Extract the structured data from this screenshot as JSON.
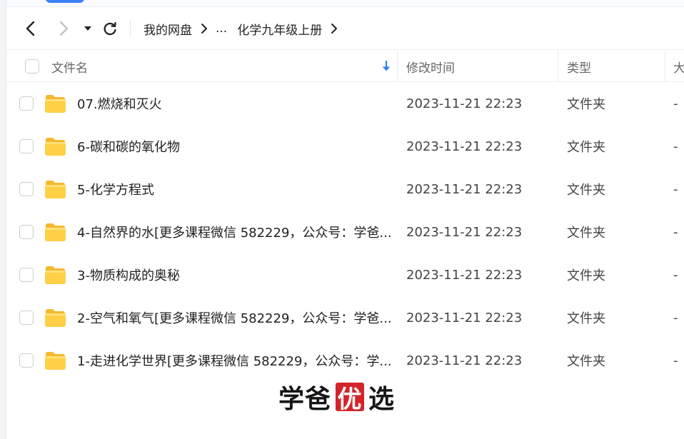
{
  "breadcrumb": {
    "root": "我的网盘",
    "ellipsis": "...",
    "current": "化学九年级上册"
  },
  "table": {
    "columns": {
      "name": "文件名",
      "modified": "修改时间",
      "type": "类型",
      "size": "大"
    },
    "sort_indicator": "arrow-down",
    "rows": [
      {
        "name": "07.燃烧和灭火",
        "modified": "2023-11-21 22:23",
        "type": "文件夹",
        "size": "-"
      },
      {
        "name": "6-碳和碳的氧化物",
        "modified": "2023-11-21 22:23",
        "type": "文件夹",
        "size": "-"
      },
      {
        "name": "5-化学方程式",
        "modified": "2023-11-21 22:23",
        "type": "文件夹",
        "size": "-"
      },
      {
        "name": "4-自然界的水[更多课程微信 582229，公众号：学爸...",
        "modified": "2023-11-21 22:23",
        "type": "文件夹",
        "size": "-"
      },
      {
        "name": "3-物质构成的奥秘",
        "modified": "2023-11-21 22:23",
        "type": "文件夹",
        "size": "-"
      },
      {
        "name": "2-空气和氧气[更多课程微信 582229，公众号：学爸...",
        "modified": "2023-11-21 22:23",
        "type": "文件夹",
        "size": "-"
      },
      {
        "name": "1-走进化学世界[更多课程微信 582229，公众号：学...",
        "modified": "2023-11-21 22:23",
        "type": "文件夹",
        "size": "-"
      }
    ]
  },
  "watermark": {
    "left": "学爸",
    "boxed": "优",
    "right": "选"
  },
  "colors": {
    "accent": "#3b82f6",
    "folder": "#ffc83d",
    "watermark_red": "#d3242b"
  }
}
